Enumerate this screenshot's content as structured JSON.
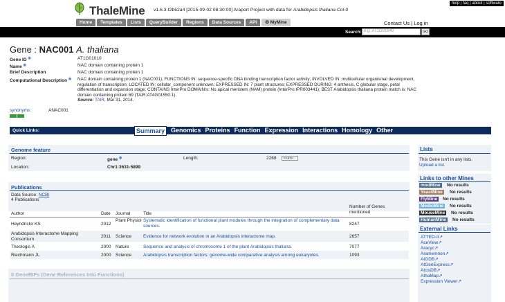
{
  "header": {
    "top_links": "help | faq | about | software",
    "brand": "ThaleMine",
    "version_prefix": "v1.6.3-f2b52a4 [2015-09-02 08:30:00] Araport Project with data for ",
    "version_species": "Arabidopsis thaliana Col-0",
    "tabs": [
      "Home",
      "Templates",
      "Lists",
      "QueryBuilder",
      "Regions",
      "Data Sources",
      "API",
      "MyMine"
    ],
    "contact": "Contact Us | Log in",
    "search_label": "Search:",
    "search_placeholder": "e.g. AT1G01640",
    "search_go": "GO"
  },
  "gene": {
    "prefix": "Gene : ",
    "symbol": "NAC001",
    "species": "A. thaliana",
    "fields": [
      {
        "label": "Gene ID",
        "value": "AT1G01010"
      },
      {
        "label": "Name",
        "value": "NAC domain containing protein 1"
      },
      {
        "label": "Brief Description",
        "value": "NAC domain containing protein 1"
      },
      {
        "label": "Computational Description",
        "value": ""
      }
    ],
    "computational_description": "NAC domain containing protein 1 (NAC001); FUNCTIONS IN: sequence-specific DNA binding transcription factor activity; INVOLVED IN: multicellular organismal development, regulation of transcription; LOCATED IN: cellular_component unknown; EXPRESSED IN: 7 plant structures; EXPRESSED DURING: 4 anthesis, C globular stage, petal differentiation and expansion stage; CONTAINS InterPro DOMAIN/s: No apical meristem (NAM) protein (InterPro:IPR003441); BEST Arabidopsis thaliana protein match is: NAC domain containing protein 69 (TAIR:AT4G01550.1).",
    "source_label": "Source:",
    "source_link": "TAIR",
    "source_date": ", Mar 31, 2014.",
    "synonyms_label": "synonyms:",
    "synonyms_value": "ANAC001"
  },
  "quick_links": {
    "label": "Quick Links:",
    "items": [
      "Summary",
      "Genomics",
      "Proteins",
      "Function",
      "Expression",
      "Interactions",
      "Homology",
      "Other"
    ]
  },
  "genome_feature": {
    "title": "Genome feature",
    "region_label": "Region:",
    "region_value": "gene",
    "length_label": "Length:",
    "length_value": "2269",
    "fasta": "FASTA...",
    "location_label": "Location:",
    "location_value": "Chr1:3631-5899"
  },
  "publications": {
    "title": "Publications",
    "data_source_label": "Data Source:",
    "data_source_link": "NCBI",
    "count_text": "4 Publications",
    "columns": [
      "Author",
      "Date",
      "Journal",
      "Title",
      "Number of Genes mentioned"
    ],
    "rows": [
      {
        "author": "Heyndrickx KS",
        "date": "2012",
        "journal": "Plant Physiol",
        "title": "Systematic identification of functional plant modules through the integration of complementary data sources.",
        "genes": "8247"
      },
      {
        "author": "Arabidopsis Interactome Mapping Consortium",
        "date": "2011",
        "journal": "Science",
        "title": "Evidence for network evolution in an Arabidopsis interactome map.",
        "genes": "2657"
      },
      {
        "author": "Theologis A",
        "date": "2000",
        "journal": "Nature",
        "title": "Sequence and analysis of chromosome 1 of the plant Arabidopsis thaliana.",
        "genes": "7077"
      },
      {
        "author": "Riechmann JL",
        "date": "2000",
        "journal": "Science",
        "title": "Arabidopsis transcription factors: genome-wide comparative analysis among eukaryotes.",
        "genes": "1093"
      }
    ]
  },
  "generifs": {
    "title": "0 GeneRIFs (Gene References Into Functions)"
  },
  "sidebar": {
    "lists_title": "Lists",
    "lists_text": "This Gene isn't in any lists.",
    "lists_link": "Upload a list.",
    "mines_title": "Links to other Mines",
    "mines": [
      {
        "name": "modMine",
        "color": "#4a6f8a",
        "result": "No results"
      },
      {
        "name": "YeastMine",
        "color": "#a08060",
        "result": "No results"
      },
      {
        "name": "FlyMine",
        "color": "#5a3c7a",
        "result": "No results"
      },
      {
        "name": "MedicMine",
        "color": "#6fb1d9",
        "result": "No results"
      },
      {
        "name": "MouseMine",
        "color": "#2a2a2a",
        "result": "No results"
      },
      {
        "name": "HumanMine",
        "color": "#4a6b86",
        "result": "No results"
      }
    ],
    "external_title": "External Links",
    "external": [
      "ATTED-II",
      "AceView",
      "Aracyc",
      "Aramemnon",
      "AtGDB",
      "AtGenExpress",
      "AtcisDB",
      "AthaMap",
      "Expression Viewer"
    ]
  }
}
